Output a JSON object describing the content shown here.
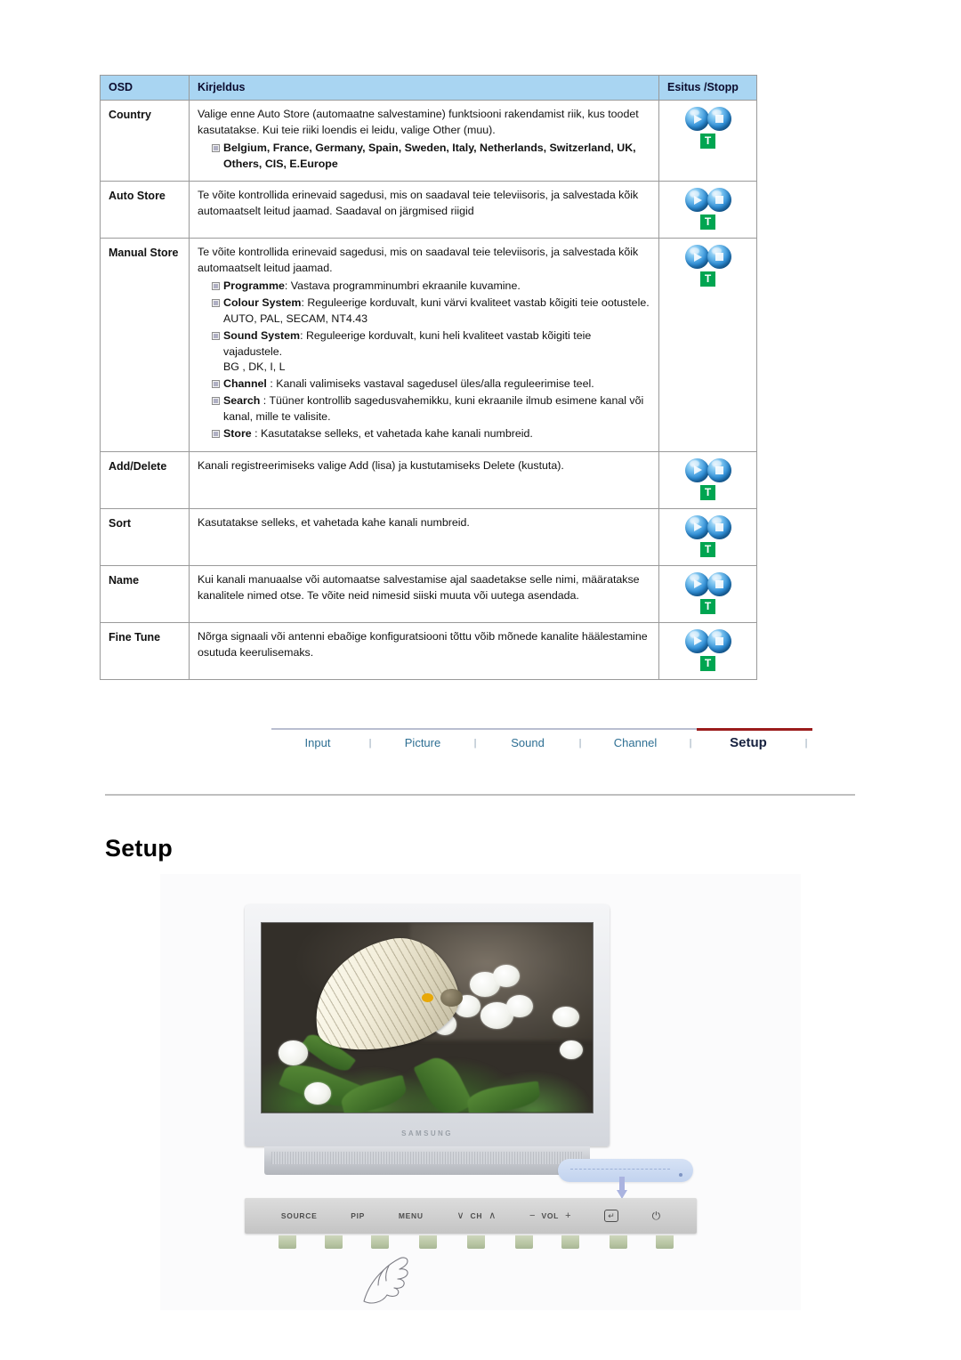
{
  "table": {
    "headers": {
      "osd": "OSD",
      "description": "Kirjeldus",
      "playstop": "Esitus /Stopp"
    },
    "rows": [
      {
        "name": "Country",
        "paragraphs": [
          "Valige enne Auto Store (automaatne salvestamine) funktsiooni rakendamist riik, kus toodet kasutatakse. Kui teie riiki loendis ei leidu, valige Other (muu)."
        ],
        "bullets": [
          {
            "term": "Belgium, France, Germany, Spain, Sweden, Italy, Netherlands, Switzerland, UK, Others, CIS, E.Europe",
            "rest": "",
            "bold_all": true
          }
        ],
        "has_playstop": true
      },
      {
        "name": "Auto Store",
        "paragraphs": [
          "Te võite kontrollida erinevaid sagedusi, mis on saadaval teie televiisoris, ja salvestada kõik automaatselt leitud jaamad. Saadaval on järgmised riigid"
        ],
        "bullets": [],
        "has_playstop": true
      },
      {
        "name": "Manual Store",
        "paragraphs": [
          "Te võite kontrollida erinevaid sagedusi, mis on saadaval teie televiisoris, ja salvestada kõik automaatselt leitud jaamad."
        ],
        "bullets": [
          {
            "term": "Programme",
            "rest": ": Vastava programminumbri ekraanile kuvamine."
          },
          {
            "term": "Colour System",
            "rest": ": Reguleerige korduvalt, kuni värvi kvaliteet vastab kõigiti teie ootustele.",
            "plain": "AUTO, PAL, SECAM, NT4.43"
          },
          {
            "term": "Sound System",
            "rest": ": Reguleerige korduvalt, kuni heli kvaliteet vastab kõigiti teie vajadustele.",
            "plain": "BG , DK, I, L"
          },
          {
            "term": "Channel",
            "rest": " : Kanali valimiseks vastaval sagedusel üles/alla reguleerimise teel."
          },
          {
            "term": "Search",
            "rest": " : Tüüner kontrollib sagedusvahemikku, kuni ekraanile ilmub esimene kanal või kanal, mille te valisite."
          },
          {
            "term": "Store",
            "rest": " : Kasutatakse selleks, et vahetada kahe kanali numbreid."
          }
        ],
        "has_playstop": true
      },
      {
        "name": "Add/Delete",
        "paragraphs": [
          "Kanali registreerimiseks valige Add (lisa) ja kustutamiseks Delete (kustuta)."
        ],
        "bullets": [],
        "has_playstop": true
      },
      {
        "name": "Sort",
        "paragraphs": [
          "Kasutatakse selleks, et vahetada kahe kanali numbreid."
        ],
        "bullets": [],
        "has_playstop": true
      },
      {
        "name": "Name",
        "paragraphs": [
          "Kui kanali manuaalse või automaatse salvestamise ajal saadetakse selle nimi, määratakse kanalitele nimed otse. Te võite neid nimesid siiski muuta või uutega asendada."
        ],
        "bullets": [],
        "has_playstop": true
      },
      {
        "name": "Fine Tune",
        "paragraphs": [
          "Nõrga signaali või antenni ebaõige konfiguratsiooni tõttu võib mõnede kanalite häälestamine osutuda keerulisemaks."
        ],
        "bullets": [],
        "has_playstop": true
      }
    ],
    "playstop_badge": "T"
  },
  "nav": {
    "items": [
      {
        "label": "Input",
        "active": false
      },
      {
        "label": "Picture",
        "active": false
      },
      {
        "label": "Sound",
        "active": false
      },
      {
        "label": "Channel",
        "active": false
      },
      {
        "label": "Setup",
        "active": true
      }
    ],
    "separator": "|",
    "active_color": "#9b1c1c",
    "link_color": "#2e6f93"
  },
  "section": {
    "title": "Setup"
  },
  "figure": {
    "brand": "SAMSUNG",
    "controls": [
      {
        "label": "SOURCE",
        "type": "text"
      },
      {
        "label": "PIP",
        "type": "text"
      },
      {
        "label": "MENU",
        "type": "text"
      },
      {
        "label": "CH",
        "type": "channel",
        "down": "∨",
        "up": "∧"
      },
      {
        "label": "VOL",
        "type": "volume",
        "minus": "−",
        "plus": "+"
      },
      {
        "label": "↵",
        "type": "enter"
      },
      {
        "label": "⏻",
        "type": "power"
      }
    ]
  }
}
